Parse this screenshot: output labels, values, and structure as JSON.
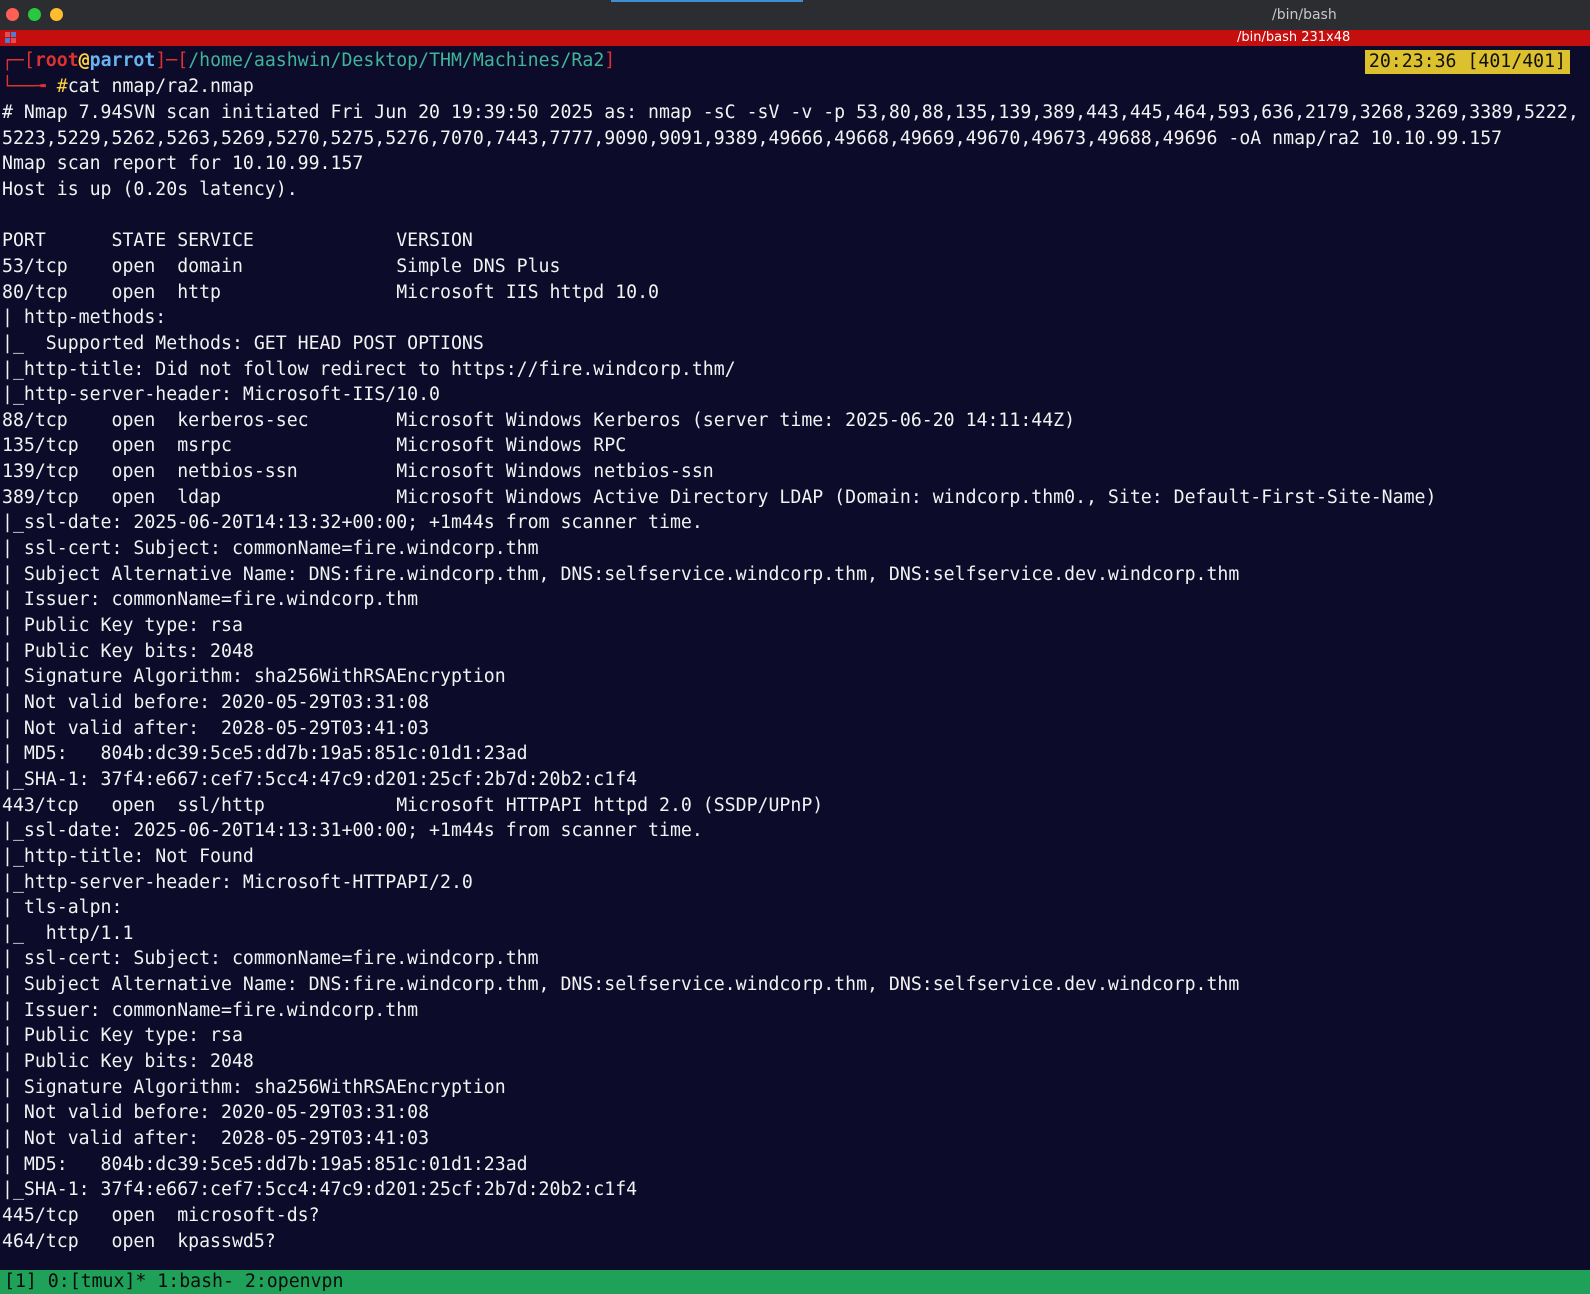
{
  "window": {
    "title": "/bin/bash"
  },
  "tmux": {
    "pane_info": "/bin/bash 231x48",
    "clock": "20:23:36 [401/401]",
    "windows": "[1] 0:[tmux]* 1:bash- 2:openvpn"
  },
  "prompt": {
    "user": "root",
    "at": "@",
    "host": "parrot",
    "path": "/home/aashwin/Desktop/THM/Machines/Ra2",
    "symbol": "#",
    "command": "cat nmap/ra2.nmap"
  },
  "output": [
    "# Nmap 7.94SVN scan initiated Fri Jun 20 19:39:50 2025 as: nmap -sC -sV -v -p 53,80,88,135,139,389,443,445,464,593,636,2179,3268,3269,3389,5222,",
    "5223,5229,5262,5263,5269,5270,5275,5276,7070,7443,7777,9090,9091,9389,49666,49668,49669,49670,49673,49688,49696 -oA nmap/ra2 10.10.99.157",
    "Nmap scan report for 10.10.99.157",
    "Host is up (0.20s latency).",
    "",
    "PORT      STATE SERVICE             VERSION",
    "53/tcp    open  domain              Simple DNS Plus",
    "80/tcp    open  http                Microsoft IIS httpd 10.0",
    "| http-methods:",
    "|_  Supported Methods: GET HEAD POST OPTIONS",
    "|_http-title: Did not follow redirect to https://fire.windcorp.thm/",
    "|_http-server-header: Microsoft-IIS/10.0",
    "88/tcp    open  kerberos-sec        Microsoft Windows Kerberos (server time: 2025-06-20 14:11:44Z)",
    "135/tcp   open  msrpc               Microsoft Windows RPC",
    "139/tcp   open  netbios-ssn         Microsoft Windows netbios-ssn",
    "389/tcp   open  ldap                Microsoft Windows Active Directory LDAP (Domain: windcorp.thm0., Site: Default-First-Site-Name)",
    "|_ssl-date: 2025-06-20T14:13:32+00:00; +1m44s from scanner time.",
    "| ssl-cert: Subject: commonName=fire.windcorp.thm",
    "| Subject Alternative Name: DNS:fire.windcorp.thm, DNS:selfservice.windcorp.thm, DNS:selfservice.dev.windcorp.thm",
    "| Issuer: commonName=fire.windcorp.thm",
    "| Public Key type: rsa",
    "| Public Key bits: 2048",
    "| Signature Algorithm: sha256WithRSAEncryption",
    "| Not valid before: 2020-05-29T03:31:08",
    "| Not valid after:  2028-05-29T03:41:03",
    "| MD5:   804b:dc39:5ce5:dd7b:19a5:851c:01d1:23ad",
    "|_SHA-1: 37f4:e667:cef7:5cc4:47c9:d201:25cf:2b7d:20b2:c1f4",
    "443/tcp   open  ssl/http            Microsoft HTTPAPI httpd 2.0 (SSDP/UPnP)",
    "|_ssl-date: 2025-06-20T14:13:31+00:00; +1m44s from scanner time.",
    "|_http-title: Not Found",
    "|_http-server-header: Microsoft-HTTPAPI/2.0",
    "| tls-alpn:",
    "|_  http/1.1",
    "| ssl-cert: Subject: commonName=fire.windcorp.thm",
    "| Subject Alternative Name: DNS:fire.windcorp.thm, DNS:selfservice.windcorp.thm, DNS:selfservice.dev.windcorp.thm",
    "| Issuer: commonName=fire.windcorp.thm",
    "| Public Key type: rsa",
    "| Public Key bits: 2048",
    "| Signature Algorithm: sha256WithRSAEncryption",
    "| Not valid before: 2020-05-29T03:31:08",
    "| Not valid after:  2028-05-29T03:41:03",
    "| MD5:   804b:dc39:5ce5:dd7b:19a5:851c:01d1:23ad",
    "|_SHA-1: 37f4:e667:cef7:5cc4:47c9:d201:25cf:2b7d:20b2:c1f4",
    "445/tcp   open  microsoft-ds?",
    "464/tcp   open  kpasswd5?"
  ]
}
